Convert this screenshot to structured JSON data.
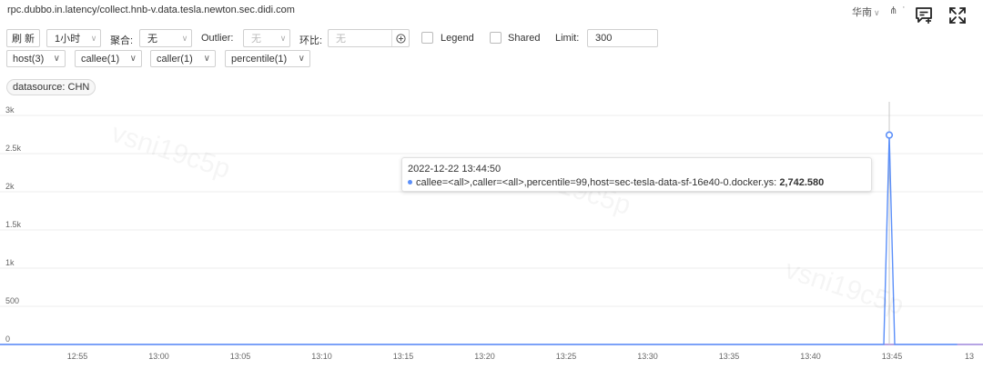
{
  "header": {
    "metric": "rpc.dubbo.in.latency/collect.hnb-v.data.tesla.newton.sec.didi.com",
    "region": "华南",
    "icons": {
      "tree": "tree-icon",
      "add_note": "note-add-icon",
      "fullscreen": "fullscreen-icon"
    }
  },
  "toolbar": {
    "refresh_label": "刷 新",
    "time_range": "1小时",
    "aggregate_label": "聚合:",
    "aggregate_value": "无",
    "outlier_label": "Outlier:",
    "outlier_value": "无",
    "compare_label": "环比:",
    "compare_placeholder": "无",
    "legend_label": "Legend",
    "shared_label": "Shared",
    "limit_label": "Limit:",
    "limit_value": "300"
  },
  "filters": [
    {
      "label": "host(3)"
    },
    {
      "label": "callee(1)"
    },
    {
      "label": "caller(1)"
    },
    {
      "label": "percentile(1)"
    }
  ],
  "datasource": "datasource: CHN",
  "colors": {
    "series": "#5b8ff9",
    "baseline": "#8a6dd3"
  },
  "tooltip": {
    "time": "2022-12-22 13:44:50",
    "series_label": "callee=<all>,caller=<all>,percentile=99,host=sec-tesla-data-sf-16e40-0.docker.ys:",
    "value": "2,742.580"
  },
  "chart_data": {
    "type": "line",
    "ylim": [
      0,
      3000
    ],
    "y_ticks": [
      "0",
      "500",
      "1k",
      "1.5k",
      "2k",
      "2.5k",
      "3k"
    ],
    "x_ticks": [
      "12:55",
      "13:00",
      "13:05",
      "13:10",
      "13:15",
      "13:20",
      "13:25",
      "13:30",
      "13:35",
      "13:40",
      "13:45",
      "13"
    ],
    "series": [
      {
        "x": [
          "12:50",
          "12:55",
          "13:00",
          "13:05",
          "13:10",
          "13:15",
          "13:20",
          "13:25",
          "13:30",
          "13:35",
          "13:40",
          "13:44:30",
          "13:44:50",
          "13:45:10",
          "13:49"
        ],
        "values": [
          0,
          0,
          0,
          0,
          0,
          0,
          0,
          0,
          0,
          0,
          0,
          0,
          2742.58,
          0,
          0
        ]
      }
    ]
  }
}
